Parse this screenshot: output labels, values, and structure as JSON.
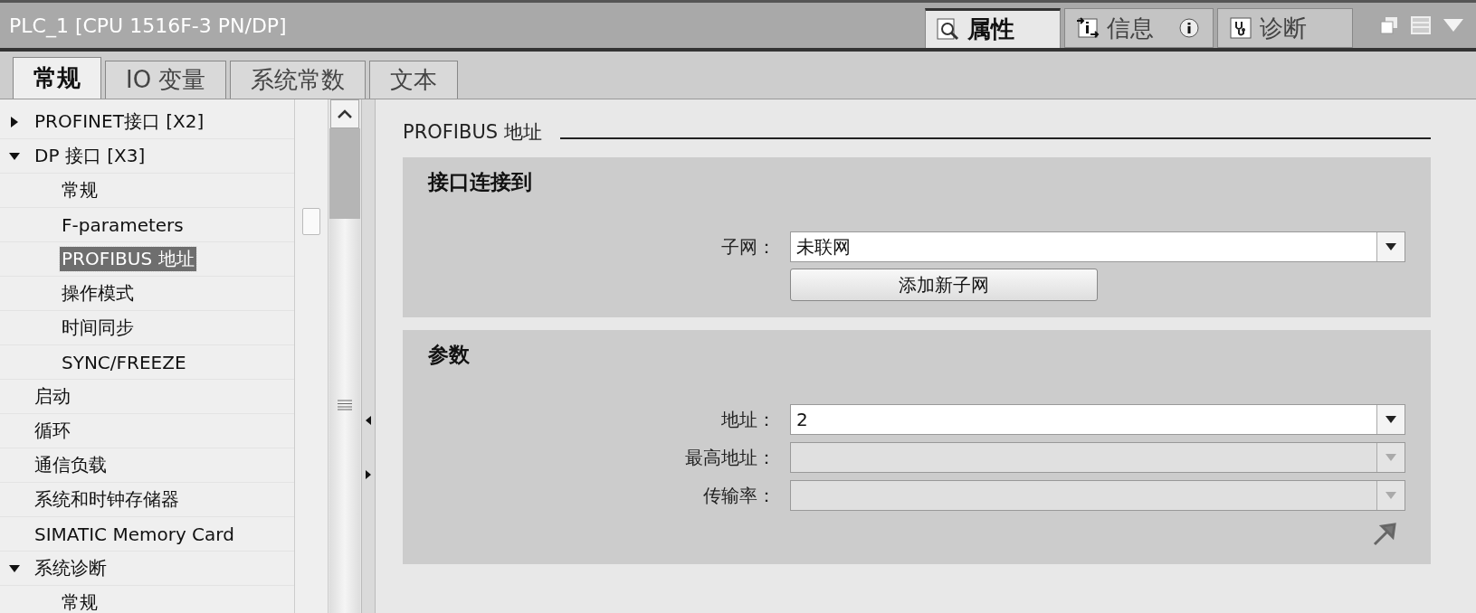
{
  "panel_title": "PLC_1 [CPU 1516F-3 PN/DP]",
  "view_tabs": [
    {
      "label": "属性",
      "kind": "properties",
      "selected": true
    },
    {
      "label": "信息",
      "kind": "info",
      "selected": false
    },
    {
      "label": "诊断",
      "kind": "diagnostics",
      "selected": false
    }
  ],
  "property_tabs": [
    {
      "label": "常规",
      "selected": true
    },
    {
      "label": "IO 变量",
      "selected": false
    },
    {
      "label": "系统常数",
      "selected": false
    },
    {
      "label": "文本",
      "selected": false
    }
  ],
  "tree": [
    {
      "label": "PROFINET接口 [X2]",
      "expanded": false,
      "selected": false
    },
    {
      "label": "DP 接口 [X3]",
      "expanded": true,
      "selected": false,
      "children": [
        {
          "label": "常规",
          "selected": false
        },
        {
          "label": "F-parameters",
          "selected": false
        },
        {
          "label": "PROFIBUS 地址",
          "selected": true
        },
        {
          "label": "操作模式",
          "selected": false
        },
        {
          "label": "时间同步",
          "selected": false
        },
        {
          "label": "SYNC/FREEZE",
          "selected": false
        }
      ]
    },
    {
      "label": "启动",
      "selected": false
    },
    {
      "label": "循环",
      "selected": false
    },
    {
      "label": "通信负载",
      "selected": false
    },
    {
      "label": "系统和时钟存储器",
      "selected": false
    },
    {
      "label": "SIMATIC Memory Card",
      "selected": false
    },
    {
      "label": "系统诊断",
      "expanded": true,
      "selected": false,
      "children": [
        {
          "label": "常规",
          "selected": false
        }
      ]
    }
  ],
  "content": {
    "heading": "PROFIBUS 地址",
    "sections": [
      {
        "title": "接口连接到",
        "rows": [
          {
            "kind": "dropdown",
            "label": "子网：",
            "value": "未联网",
            "disabled": false
          },
          {
            "kind": "button",
            "label": "添加新子网"
          }
        ]
      },
      {
        "title": "参数",
        "rows": [
          {
            "kind": "dropdown",
            "label": "地址：",
            "value": "2",
            "disabled": false
          },
          {
            "kind": "dropdown",
            "label": "最高地址：",
            "disabled": true
          },
          {
            "kind": "dropdown",
            "label": "传输率：",
            "disabled": true
          },
          {
            "kind": "link"
          }
        ]
      }
    ]
  }
}
